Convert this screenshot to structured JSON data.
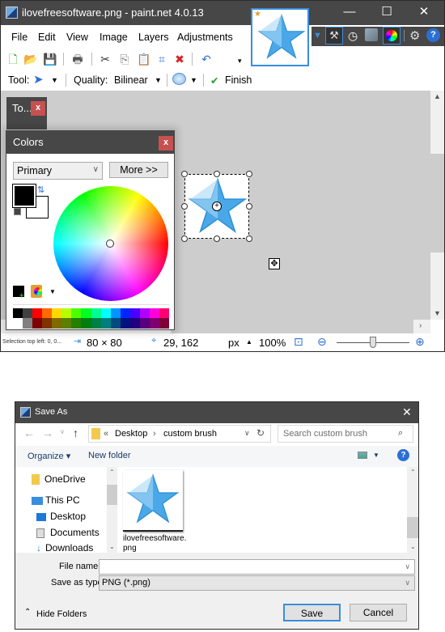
{
  "paintnet": {
    "title": "ilovefreesoftware.png - paint.net 4.0.13",
    "window_controls": {
      "minimize": "—",
      "maximize": "☐",
      "close": "✕"
    },
    "menu": [
      "File",
      "Edit",
      "View",
      "Image",
      "Layers",
      "Adjustments"
    ],
    "toolbar_icons": [
      "new-image-icon",
      "open-icon",
      "save-icon",
      "print-icon",
      "cut-icon",
      "copy-icon",
      "paste-icon",
      "crop-icon",
      "deselect-icon",
      "undo-icon"
    ],
    "right_icons": [
      "tools-icon",
      "history-icon",
      "layers-icon",
      "colors-icon",
      "settings-icon",
      "help-icon"
    ],
    "tool_label": "Tool:",
    "quality_label": "Quality:",
    "quality_value": "Bilinear",
    "finish_label": "Finish",
    "tools_window": {
      "title": "To..."
    },
    "colors_window": {
      "title": "Colors",
      "close": "x",
      "mode_select": "Primary",
      "more_button": "More >>",
      "primary_color": "#000000",
      "secondary_color": "#ffffff",
      "palette_top": [
        "#000000",
        "#404040",
        "#ff0000",
        "#ff6a00",
        "#ffd800",
        "#b6ff00",
        "#4cff00",
        "#00ff21",
        "#00ff90",
        "#00ffff",
        "#0094ff",
        "#0026ff",
        "#4800ff",
        "#b200ff",
        "#ff00dc",
        "#ff006e"
      ],
      "palette_bottom": [
        "#ffffff",
        "#808080",
        "#7f0000",
        "#7f3300",
        "#7f6a00",
        "#5b7f00",
        "#267f00",
        "#007f0e",
        "#007f46",
        "#007f7f",
        "#004a7f",
        "#00137f",
        "#21007f",
        "#57007f",
        "#7f006e",
        "#7f0037"
      ]
    },
    "status": {
      "hint": "Selection top left: 0, 0...",
      "selection_size": "80 × 80",
      "cursor_pos": "29, 162",
      "units": "px",
      "zoom": "100%",
      "zoom_slider_fraction": 0.5
    }
  },
  "save_as": {
    "title": "Save As",
    "close": "✕",
    "breadcrumb": [
      "«",
      "Desktop",
      "›",
      "custom brush"
    ],
    "search_placeholder": "Search custom brush",
    "organize": "Organize ▾",
    "new_folder": "New folder",
    "tree": [
      "OneDrive",
      "This PC",
      "Desktop",
      "Documents",
      "Downloads"
    ],
    "files": [
      {
        "name": "ilovefreesoftware.png",
        "name_line1": "ilovefreesoftware.",
        "name_line2": "png"
      }
    ],
    "file_name_label": "File name:",
    "file_name_value": "",
    "save_type_label": "Save as type:",
    "save_type_value": "PNG (*.png)",
    "hide_folders": "Hide Folders",
    "save_button": "Save",
    "cancel_button": "Cancel"
  }
}
